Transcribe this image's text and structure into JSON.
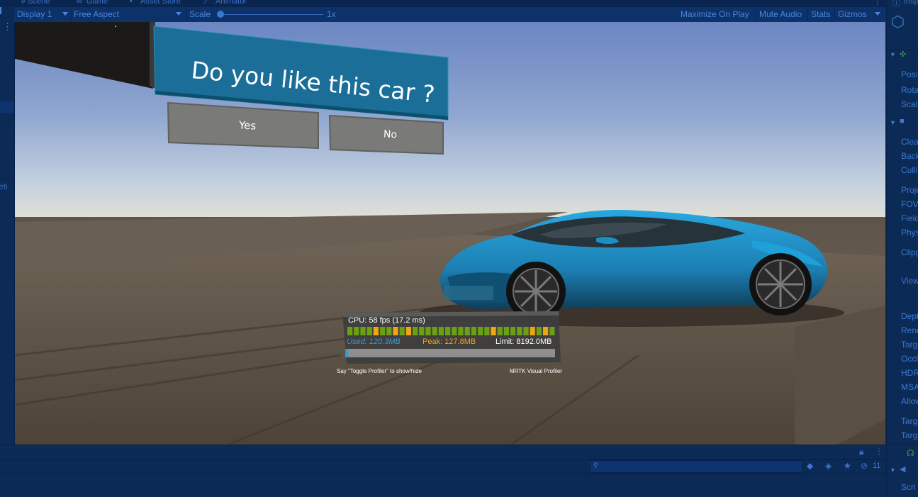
{
  "tabs": [
    {
      "label": "# Scene"
    },
    {
      "label": "Game"
    },
    {
      "label": "Asset Store"
    },
    {
      "label": "Animator"
    }
  ],
  "toolbar": {
    "display": "Display 1",
    "aspect": "Free Aspect",
    "scale_label": "Scale",
    "scale_value": "1x",
    "maximize": "Maximize On Play",
    "mute": "Mute Audio",
    "stats": "Stats",
    "gizmos": "Gizmos"
  },
  "left_strip": {
    "partial_text": "eti"
  },
  "dialog": {
    "question": "Do you like this car ?",
    "yes": "Yes",
    "no": "No"
  },
  "profiler": {
    "cpu": "CPU: 58 fps (17.2 ms)",
    "used": "Used: 120.3MB",
    "peak": "Peak: 127.8MB",
    "limit": "Limit: 8192.0MB",
    "hint": "Say \"Toggle Profiler\" to show/hide",
    "brand": "MRTK Visual Profiler",
    "frame_bars": [
      "g",
      "g",
      "g",
      "g",
      "o",
      "g",
      "g",
      "o",
      "g",
      "o",
      "g",
      "g",
      "g",
      "g",
      "g",
      "g",
      "g",
      "g",
      "g",
      "g",
      "g",
      "g",
      "o",
      "g",
      "g",
      "g",
      "g",
      "g",
      "o",
      "g",
      "o",
      "g"
    ],
    "memory_used_fraction": 0.015
  },
  "inspector": {
    "header": "Insp",
    "labels": [
      "Posi",
      "Rota",
      "Scal",
      "Clea",
      "Back",
      "Culli",
      "Proje",
      "FOV",
      "Field",
      "Phys",
      "Clipp",
      "View",
      "Depth",
      "Rend",
      "Targ",
      "Occl",
      "HDR",
      "MSA",
      "Allow",
      "Targ",
      "Targ",
      "Scri"
    ]
  },
  "bottom": {
    "hidden_count": "11"
  },
  "colors": {
    "editor_bg": "#0b2a55",
    "accent": "#3f7fd9",
    "dialog_blue": "#1a6e98",
    "button_gray": "#7a7a78",
    "car_blue": "#1f8fc7",
    "bar_green": "#6aa114",
    "bar_orange": "#f0a514",
    "used_blue": "#2f9ae0",
    "peak_orange": "#f0a514"
  }
}
